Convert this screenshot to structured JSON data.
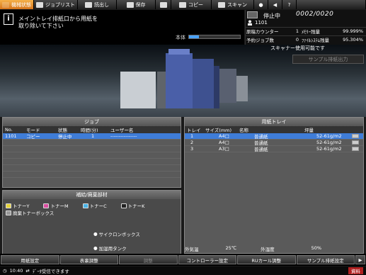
{
  "tabs": [
    {
      "label": "機械状態",
      "active": true
    },
    {
      "label": "ジョブリスト",
      "active": false
    },
    {
      "label": "読出し",
      "active": false
    },
    {
      "label": "保存",
      "active": false
    },
    {
      "label": "コピー",
      "active": false
    },
    {
      "label": "スキャン",
      "active": false
    }
  ],
  "message": {
    "line1": "メイントレイ排紙口から用紙を",
    "line2": "取り除いて下さい"
  },
  "honntai": {
    "label": "本体",
    "progress": 0.2
  },
  "status": {
    "state": "停止中",
    "job_count": "0002/0020",
    "user": "1101",
    "grid": [
      [
        "原稿カウンター",
        "1",
        "ﾒﾓﾘｰ残量",
        "99.999%"
      ],
      [
        "予約ジョブ数",
        "0",
        "ﾌｧｲﾙｼｽﾃﾑ残量",
        "95.304%"
      ]
    ]
  },
  "scanner_status": "スキャナー使用可能です",
  "sample_button": "サンプル排紙出力",
  "job": {
    "title": "ジョブ",
    "headers": [
      "No.",
      "モード",
      "状態",
      "時間(分)",
      "ユーザー名"
    ],
    "rows": [
      [
        "1101",
        "コピー",
        "停止中",
        "1",
        "----------------"
      ]
    ]
  },
  "tray": {
    "title": "用紙トレイ",
    "headers": [
      "トレイ",
      "サイズ(mm)",
      "名称",
      "坪量"
    ],
    "rows": [
      [
        "1",
        "A4□",
        "普通紙",
        "52-61g/m2"
      ],
      [
        "2",
        "A4□",
        "普通紙",
        "52-61g/m2"
      ],
      [
        "3",
        "A3□",
        "普通紙",
        "52-61g/m2"
      ]
    ]
  },
  "consumables": {
    "title": "補給/廃棄部材",
    "toners": [
      {
        "label": "トナーY",
        "color": "#e6d33a"
      },
      {
        "label": "トナーM",
        "color": "#d84fa0"
      },
      {
        "label": "トナーC",
        "color": "#4ab3e6"
      },
      {
        "label": "トナーK",
        "color": "#222222"
      }
    ],
    "waste": "廃棄トナーボックス",
    "cyclone": "サイクロンボックス",
    "humid": "加湿用タンク"
  },
  "ambient": {
    "temp_label": "外気温",
    "temp": "25℃",
    "humid_label": "外湿度",
    "humid": "50%"
  },
  "bottom_buttons": [
    {
      "label": "用紙設定",
      "disabled": false
    },
    {
      "label": "表裏調整",
      "disabled": false
    },
    {
      "label": "調整",
      "disabled": true
    },
    {
      "label": "コントローラー設定",
      "disabled": false
    },
    {
      "label": "RUカール調整",
      "disabled": false
    },
    {
      "label": "サンプル排紙設定",
      "disabled": false
    }
  ],
  "footer": {
    "time": "10:40",
    "msg": "ﾃﾞｰﾀ受信できます",
    "right": "資料"
  }
}
